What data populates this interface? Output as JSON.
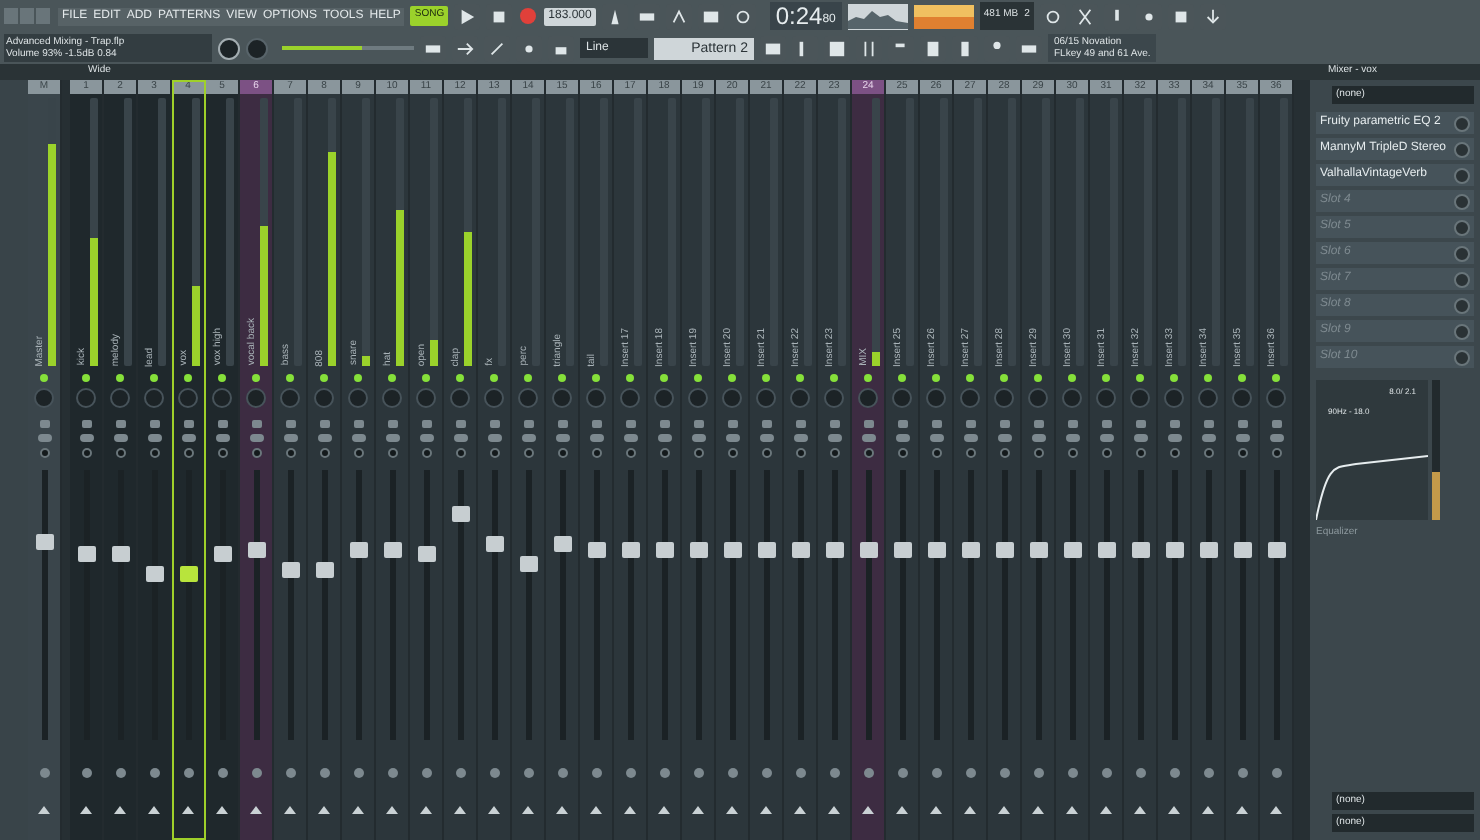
{
  "menu": [
    "FILE",
    "EDIT",
    "ADD",
    "PATTERNS",
    "VIEW",
    "OPTIONS",
    "TOOLS",
    "HELP"
  ],
  "transport": {
    "mode": "SONG",
    "tempo": "183.000",
    "time": "0:24",
    "time_small": "80"
  },
  "memory": {
    "ram": "481 MB",
    "voices": "2"
  },
  "hint": {
    "title": "Advanced Mixing - Trap.flp",
    "line": "Volume 93%  -1.5dB  0.84"
  },
  "master_volume": {
    "level": 0.6
  },
  "snap": "Line",
  "pattern": "Pattern 2",
  "device": {
    "line1": "06/15  Novation",
    "line2": "FLkey 49 and 61 Ave."
  },
  "view_label": "Wide",
  "mixer": {
    "master": {
      "number": "M",
      "name": "Master",
      "meter": {
        "level": 0.83
      },
      "fader": {
        "level": 0.75
      }
    },
    "tracks": [
      {
        "number": "1",
        "name": "kick",
        "meter": {
          "level": 0.48
        },
        "fader": {
          "level": 0.7
        },
        "selected": false,
        "tinted": false
      },
      {
        "number": "2",
        "name": "melody",
        "meter": {
          "level": 0
        },
        "fader": {
          "level": 0.7
        },
        "selected": false,
        "tinted": false
      },
      {
        "number": "3",
        "name": "lead",
        "meter": {
          "level": 0
        },
        "fader": {
          "level": 0.62
        },
        "selected": false,
        "tinted": false
      },
      {
        "number": "4",
        "name": "vox",
        "meter": {
          "level": 0.3
        },
        "fader": {
          "level": 0.62
        },
        "selected": true,
        "tinted": false
      },
      {
        "number": "5",
        "name": "vox high",
        "meter": {
          "level": 0
        },
        "fader": {
          "level": 0.7
        },
        "selected": false,
        "tinted": false
      },
      {
        "number": "6",
        "name": "vocal back",
        "meter": {
          "level": 0.52
        },
        "fader": {
          "level": 0.72
        },
        "selected": false,
        "tinted": true
      },
      {
        "number": "7",
        "name": "bass",
        "meter": {
          "level": 0
        },
        "fader": {
          "level": 0.64
        },
        "selected": false,
        "tinted": false
      },
      {
        "number": "8",
        "name": "808",
        "meter": {
          "level": 0.8
        },
        "fader": {
          "level": 0.64
        },
        "selected": false,
        "tinted": false
      },
      {
        "number": "9",
        "name": "snare",
        "meter": {
          "level": 0.04
        },
        "fader": {
          "level": 0.72
        },
        "selected": false,
        "tinted": false
      },
      {
        "number": "10",
        "name": "hat",
        "meter": {
          "level": 0.58
        },
        "fader": {
          "level": 0.72
        },
        "selected": false,
        "tinted": false
      },
      {
        "number": "11",
        "name": "open",
        "meter": {
          "level": 0.1
        },
        "fader": {
          "level": 0.7
        },
        "selected": false,
        "tinted": false
      },
      {
        "number": "12",
        "name": "clap",
        "meter": {
          "level": 0.5
        },
        "fader": {
          "level": 0.86
        },
        "selected": false,
        "tinted": false
      },
      {
        "number": "13",
        "name": "fx",
        "meter": {
          "level": 0
        },
        "fader": {
          "level": 0.74
        },
        "selected": false,
        "tinted": false
      },
      {
        "number": "14",
        "name": "perc",
        "meter": {
          "level": 0
        },
        "fader": {
          "level": 0.66
        },
        "selected": false,
        "tinted": false
      },
      {
        "number": "15",
        "name": "triangle",
        "meter": {
          "level": 0
        },
        "fader": {
          "level": 0.74
        },
        "selected": false,
        "tinted": false
      },
      {
        "number": "16",
        "name": "tail",
        "meter": {
          "level": 0
        },
        "fader": {
          "level": 0.72
        },
        "selected": false,
        "tinted": false
      },
      {
        "number": "17",
        "name": "Insert 17",
        "meter": {
          "level": 0
        },
        "fader": {
          "level": 0.72
        },
        "selected": false,
        "tinted": false
      },
      {
        "number": "18",
        "name": "Insert 18",
        "meter": {
          "level": 0
        },
        "fader": {
          "level": 0.72
        },
        "selected": false,
        "tinted": false
      },
      {
        "number": "19",
        "name": "Insert 19",
        "meter": {
          "level": 0
        },
        "fader": {
          "level": 0.72
        },
        "selected": false,
        "tinted": false
      },
      {
        "number": "20",
        "name": "Insert 20",
        "meter": {
          "level": 0
        },
        "fader": {
          "level": 0.72
        },
        "selected": false,
        "tinted": false
      },
      {
        "number": "21",
        "name": "Insert 21",
        "meter": {
          "level": 0
        },
        "fader": {
          "level": 0.72
        },
        "selected": false,
        "tinted": false
      },
      {
        "number": "22",
        "name": "Insert 22",
        "meter": {
          "level": 0
        },
        "fader": {
          "level": 0.72
        },
        "selected": false,
        "tinted": false
      },
      {
        "number": "23",
        "name": "Insert 23",
        "meter": {
          "level": 0
        },
        "fader": {
          "level": 0.72
        },
        "selected": false,
        "tinted": false
      },
      {
        "number": "24",
        "name": "MIX",
        "meter": {
          "level": 0.05
        },
        "fader": {
          "level": 0.72
        },
        "selected": false,
        "tinted": true
      },
      {
        "number": "25",
        "name": "Insert 25",
        "meter": {
          "level": 0
        },
        "fader": {
          "level": 0.72
        },
        "selected": false,
        "tinted": false
      },
      {
        "number": "26",
        "name": "Insert 26",
        "meter": {
          "level": 0
        },
        "fader": {
          "level": 0.72
        },
        "selected": false,
        "tinted": false
      },
      {
        "number": "27",
        "name": "Insert 27",
        "meter": {
          "level": 0
        },
        "fader": {
          "level": 0.72
        },
        "selected": false,
        "tinted": false
      },
      {
        "number": "28",
        "name": "Insert 28",
        "meter": {
          "level": 0
        },
        "fader": {
          "level": 0.72
        },
        "selected": false,
        "tinted": false
      },
      {
        "number": "29",
        "name": "Insert 29",
        "meter": {
          "level": 0
        },
        "fader": {
          "level": 0.72
        },
        "selected": false,
        "tinted": false
      },
      {
        "number": "30",
        "name": "Insert 30",
        "meter": {
          "level": 0
        },
        "fader": {
          "level": 0.72
        },
        "selected": false,
        "tinted": false
      },
      {
        "number": "31",
        "name": "Insert 31",
        "meter": {
          "level": 0
        },
        "fader": {
          "level": 0.72
        },
        "selected": false,
        "tinted": false
      },
      {
        "number": "32",
        "name": "Insert 32",
        "meter": {
          "level": 0
        },
        "fader": {
          "level": 0.72
        },
        "selected": false,
        "tinted": false
      },
      {
        "number": "33",
        "name": "Insert 33",
        "meter": {
          "level": 0
        },
        "fader": {
          "level": 0.72
        },
        "selected": false,
        "tinted": false
      },
      {
        "number": "34",
        "name": "Insert 34",
        "meter": {
          "level": 0
        },
        "fader": {
          "level": 0.72
        },
        "selected": false,
        "tinted": false
      },
      {
        "number": "35",
        "name": "Insert 35",
        "meter": {
          "level": 0
        },
        "fader": {
          "level": 0.72
        },
        "selected": false,
        "tinted": false
      },
      {
        "number": "36",
        "name": "Insert 36",
        "meter": {
          "level": 0
        },
        "fader": {
          "level": 0.72
        },
        "selected": false,
        "tinted": false
      }
    ]
  },
  "panel": {
    "title": "Mixer - vox",
    "input": "(none)",
    "slots": [
      {
        "name": "Fruity parametric EQ 2",
        "empty": false
      },
      {
        "name": "MannyM TripleD Stereo",
        "empty": false
      },
      {
        "name": "ValhallaVintageVerb",
        "empty": false
      },
      {
        "name": "Slot 4",
        "empty": true
      },
      {
        "name": "Slot 5",
        "empty": true
      },
      {
        "name": "Slot 6",
        "empty": true
      },
      {
        "name": "Slot 7",
        "empty": true
      },
      {
        "name": "Slot 8",
        "empty": true
      },
      {
        "name": "Slot 9",
        "empty": true
      },
      {
        "name": "Slot 10",
        "empty": true
      }
    ],
    "eq": {
      "readout": "8.0/ 2.1",
      "point": "90Hz - 18.0",
      "label": "Equalizer"
    },
    "volume": {
      "level": 0.35
    },
    "outputs": [
      "(none)",
      "(none)"
    ]
  }
}
